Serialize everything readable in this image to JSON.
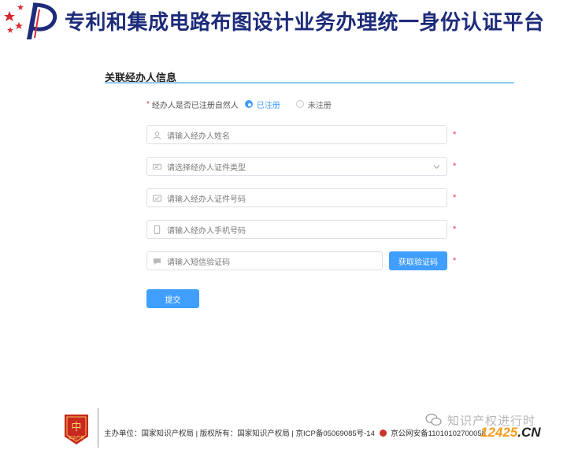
{
  "header": {
    "title": "专利和集成电路布图设计业务办理统一身份认证平台",
    "logo_icon": "emblem-logo-icon"
  },
  "section": {
    "title": "关联经办人信息"
  },
  "registration": {
    "label": "经办人是否已注册自然人",
    "option_registered": "已注册",
    "option_unregistered": "未注册",
    "selected": "已注册"
  },
  "fields": {
    "name_placeholder": "请输入经办人姓名",
    "id_type_placeholder": "请选择经办人证件类型",
    "id_number_placeholder": "请输入经办人证件号码",
    "phone_placeholder": "请输入经办人手机号码",
    "sms_placeholder": "请输入短信验证码",
    "required_mark": "*"
  },
  "buttons": {
    "get_code": "获取验证码",
    "submit": "提交"
  },
  "footer": {
    "emblem_label": "知识产权",
    "host": "主办单位：国家知识产权局",
    "copyright": "版权所有：国家知识产权局",
    "icp": "京ICP备05069085号-14",
    "police": "京公网安备11010102700058"
  },
  "watermark": {
    "wechat_text": "知识产权进行时",
    "site_num": "12425",
    "site_tld": ".CN"
  },
  "colors": {
    "primary": "#409eff",
    "title_navy": "#1d2b7a",
    "required": "#e0393e",
    "watermark_orange": "#f39c1e"
  }
}
